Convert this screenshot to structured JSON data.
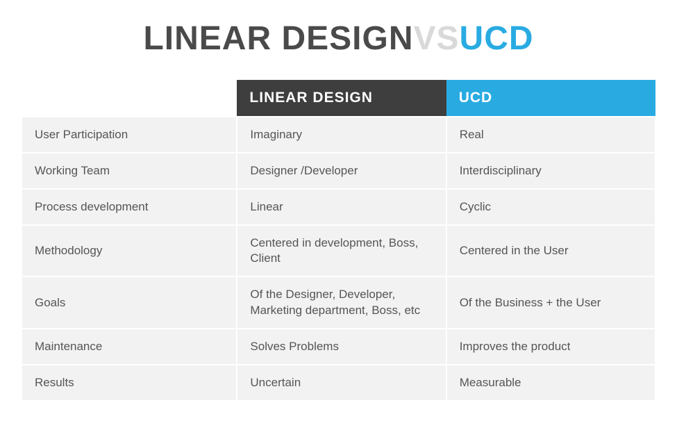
{
  "title": {
    "part1": "LINEAR DESIGN",
    "vs": "VS",
    "part2": "UCD"
  },
  "headers": {
    "col1": "LINEAR DESIGN",
    "col2": "UCD"
  },
  "rows": [
    {
      "label": "User Participation",
      "col1": "Imaginary",
      "col2": "Real"
    },
    {
      "label": "Working Team",
      "col1": "Designer /Developer",
      "col2": " Interdisciplinary"
    },
    {
      "label": "Process development",
      "col1": "Linear",
      "col2": "Cyclic"
    },
    {
      "label": "Methodology",
      "col1": "Centered in development, Boss, Client",
      "col2": "Centered in the User"
    },
    {
      "label": "Goals",
      "col1": "Of the Designer, Developer, Marketing department, Boss, etc",
      "col2": "Of the Business + the User"
    },
    {
      "label": "Maintenance",
      "col1": "Solves Problems",
      "col2": "Improves the product"
    },
    {
      "label": "Results",
      "col1": "Uncertain",
      "col2": "Measurable"
    }
  ],
  "chart_data": {
    "type": "table",
    "title": "Linear Design vs UCD",
    "columns": [
      "",
      "Linear Design",
      "UCD"
    ],
    "rows": [
      [
        "User Participation",
        "Imaginary",
        "Real"
      ],
      [
        "Working Team",
        "Designer /Developer",
        "Interdisciplinary"
      ],
      [
        "Process development",
        "Linear",
        "Cyclic"
      ],
      [
        "Methodology",
        "Centered in development, Boss, Client",
        "Centered in the User"
      ],
      [
        "Goals",
        "Of the Designer, Developer, Marketing department, Boss, etc",
        "Of the Business + the User"
      ],
      [
        "Maintenance",
        "Solves Problems",
        "Improves the product"
      ],
      [
        "Results",
        "Uncertain",
        "Measurable"
      ]
    ]
  }
}
